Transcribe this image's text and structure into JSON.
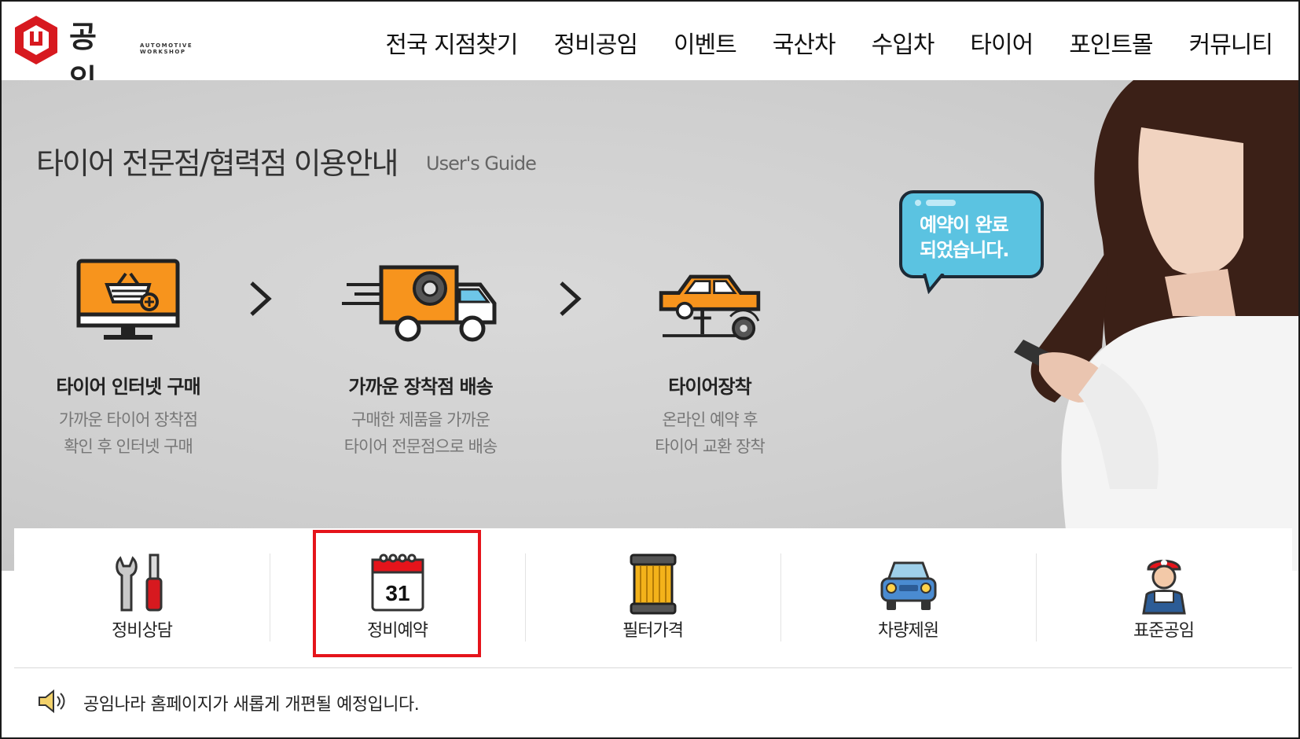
{
  "header": {
    "brand": "공임나라",
    "brand_sub": "AUTOMOTIVE WORKSHOP",
    "nav": [
      "전국 지점찾기",
      "정비공임",
      "이벤트",
      "국산차",
      "수입차",
      "타이어",
      "포인트몰",
      "커뮤니티"
    ]
  },
  "hero": {
    "title": "타이어 전문점/협력점 이용안내",
    "subtitle": "User's Guide",
    "steps": [
      {
        "icon": "monitor-cart-icon",
        "title": "타이어 인터넷 구매",
        "desc1": "가까운 타이어 장착점",
        "desc2": "확인 후  인터넷 구매"
      },
      {
        "icon": "delivery-truck-icon",
        "title": "가까운 장착점 배송",
        "desc1": "구매한 제품을 가까운",
        "desc2": "타이어 전문점으로 배송"
      },
      {
        "icon": "car-lift-icon",
        "title": "타이어장착",
        "desc1": "온라인 예약 후",
        "desc2": "타이어 교환 장착"
      }
    ],
    "bubble": {
      "line1": "예약이 완료",
      "line2": "되었습니다."
    }
  },
  "quick_menu": [
    {
      "icon": "wrench-screwdriver-icon",
      "label": "정비상담"
    },
    {
      "icon": "calendar-icon",
      "label": "정비예약",
      "calendar_day": "31"
    },
    {
      "icon": "oil-filter-icon",
      "label": "필터가격"
    },
    {
      "icon": "car-front-icon",
      "label": "차량제원"
    },
    {
      "icon": "mechanic-icon",
      "label": "표준공임"
    }
  ],
  "notice": {
    "icon": "speaker-icon",
    "text": "공임나라 홈페이지가 새롭게 개편될 예정입니다."
  },
  "colors": {
    "accent_orange": "#f7941d",
    "highlight_red": "#e5141b",
    "brand_red": "#d7191f",
    "bubble_blue": "#5bc3e1"
  }
}
